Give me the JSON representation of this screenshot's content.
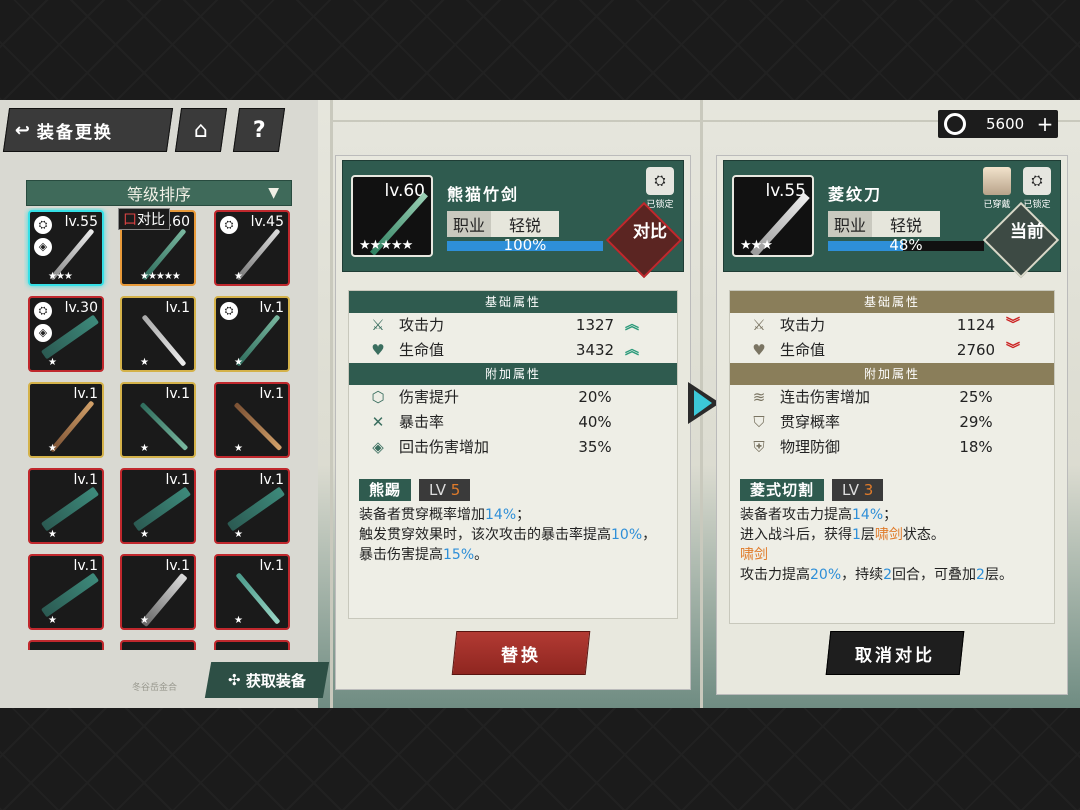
{
  "header": {
    "title": "装备更换",
    "home_icon": "home-icon",
    "help": "?"
  },
  "currency": {
    "amount": "5600",
    "plus": "+"
  },
  "sort": {
    "label": "等级排序"
  },
  "compare_tag": {
    "icon": "口",
    "label": "对比"
  },
  "list": [
    {
      "lv": "lv.55",
      "stars": "★★★"
    },
    {
      "lv": "lv.60",
      "stars": "★★★★★"
    },
    {
      "lv": "lv.45",
      "stars": "★"
    },
    {
      "lv": "lv.30",
      "stars": "★"
    },
    {
      "lv": "lv.1",
      "stars": "★"
    },
    {
      "lv": "lv.1",
      "stars": "★"
    },
    {
      "lv": "lv.1",
      "stars": "★"
    },
    {
      "lv": "lv.1",
      "stars": "★"
    },
    {
      "lv": "lv.1",
      "stars": "★"
    },
    {
      "lv": "lv.1",
      "stars": "★"
    },
    {
      "lv": "lv.1",
      "stars": "★"
    },
    {
      "lv": "lv.1",
      "stars": "★"
    },
    {
      "lv": "lv.1",
      "stars": "★"
    },
    {
      "lv": "lv.1",
      "stars": "★"
    },
    {
      "lv": "lv.1",
      "stars": "★"
    }
  ],
  "get_equipment": "获取装备",
  "watermark": "冬谷岳金合",
  "selected": {
    "lv": "lv.60",
    "name": "熊猫竹剑",
    "stars": "★★★★★",
    "job_label": "职业",
    "job": "轻锐",
    "progress": "100%",
    "progress_value": 100,
    "lock_label": "已锁定",
    "badge": "对比",
    "base_title": "基础属性",
    "base": [
      {
        "name": "攻击力",
        "value": "1327",
        "trend": "up"
      },
      {
        "name": "生命值",
        "value": "3432",
        "trend": "up"
      }
    ],
    "extra_title": "附加属性",
    "extra": [
      {
        "name": "伤害提升",
        "value": "20%"
      },
      {
        "name": "暴击率",
        "value": "40%"
      },
      {
        "name": "回击伤害增加",
        "value": "35%"
      }
    ],
    "skill_name": "熊踢",
    "skill_lv_label": "LV",
    "skill_lv": "5",
    "skill_line1_a": "装备者贯穿概率增加",
    "skill_line1_b": "14%",
    "skill_line1_c": "；",
    "skill_line2_a": "触发贯穿效果时，该次攻击的暴击率提高",
    "skill_line2_b": "10%",
    "skill_line2_c": "，暴击伤害提高",
    "skill_line2_d": "15%",
    "skill_line2_e": "。",
    "action": "替换"
  },
  "current": {
    "lv": "lv.55",
    "name": "菱纹刀",
    "stars": "★★★",
    "job_label": "职业",
    "job": "轻锐",
    "progress": "48%",
    "progress_value": 48,
    "worn_label": "已穿戴",
    "lock_label": "已锁定",
    "badge": "当前",
    "base_title": "基础属性",
    "base": [
      {
        "name": "攻击力",
        "value": "1124",
        "trend": "down"
      },
      {
        "name": "生命值",
        "value": "2760",
        "trend": "down"
      }
    ],
    "extra_title": "附加属性",
    "extra": [
      {
        "name": "连击伤害增加",
        "value": "25%"
      },
      {
        "name": "贯穿概率",
        "value": "29%"
      },
      {
        "name": "物理防御",
        "value": "18%"
      }
    ],
    "skill_name": "菱式切割",
    "skill_lv_label": "LV",
    "skill_lv": "3",
    "skill_line1_a": "装备者攻击力提高",
    "skill_line1_b": "14%",
    "skill_line1_c": "；",
    "skill_line2_a": "进入战斗后，获得",
    "skill_line2_b": "1",
    "skill_line2_c": "层",
    "skill_line2_d": "啸剑",
    "skill_line2_e": "状态。",
    "skill_line3": "啸剑",
    "skill_line4_a": "攻击力提高",
    "skill_line4_b": "20%",
    "skill_line4_c": "，持续",
    "skill_line4_d": "2",
    "skill_line4_e": "回合，可叠加",
    "skill_line4_f": "2",
    "skill_line4_g": "层。",
    "action": "取消对比"
  }
}
